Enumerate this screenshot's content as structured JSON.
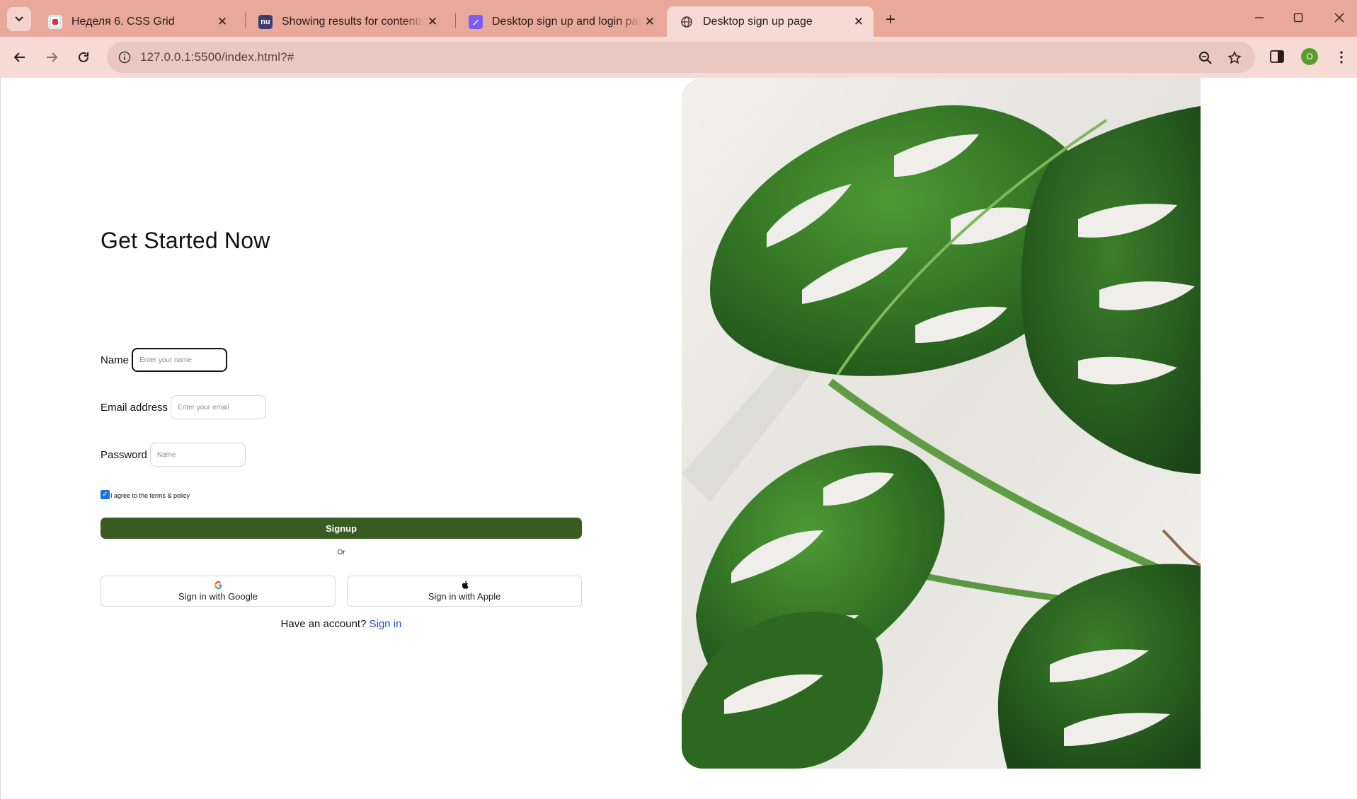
{
  "browser": {
    "tabs": [
      {
        "title": "Неделя 6. CSS Grid",
        "favicon": "red-doc-favicon",
        "active": false
      },
      {
        "title": "Showing results for contents of",
        "favicon": "nu-favicon",
        "active": false
      },
      {
        "title": "Desktop sign up and login page",
        "favicon": "purple-pen-favicon",
        "active": false
      },
      {
        "title": "Desktop sign up page",
        "favicon": "globe-icon",
        "active": true
      }
    ],
    "url": "127.0.0.1:5500/index.html?#",
    "profile_initial": "O",
    "colors": {
      "frame": "#e8a99b",
      "active_tab": "#f5dbd4",
      "omnibox": "#e8c8c0"
    }
  },
  "page": {
    "title": "Get Started Now",
    "fields": {
      "name": {
        "label": "Name",
        "placeholder": "Enter your name",
        "value": ""
      },
      "email": {
        "label": "Email address",
        "placeholder": "Enter your email",
        "value": ""
      },
      "password": {
        "label": "Password",
        "placeholder": "Name",
        "value": ""
      }
    },
    "terms": {
      "label": "I agree to the terms & policy",
      "checked": true
    },
    "signup_label": "Signup",
    "or_label": "Or",
    "google_label": "Sign in with Google",
    "apple_label": "Sign in with Apple",
    "have_account_text": "Have an account?",
    "sign_in_link": "Sign in",
    "colors": {
      "primary": "#3a5b22",
      "link": "#1d4fd8",
      "checkbox": "#1a73e8"
    },
    "hero_image": "monstera-leaves-photo"
  }
}
